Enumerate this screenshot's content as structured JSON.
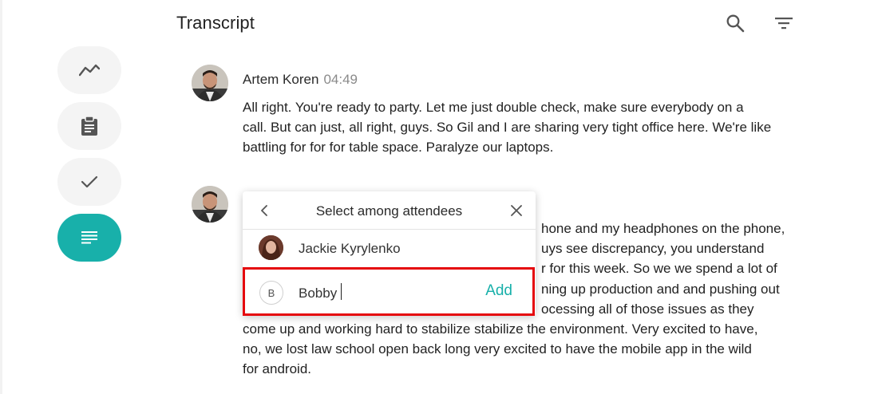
{
  "page": {
    "title": "Transcript"
  },
  "toolbar": {
    "search_icon": "search-icon",
    "filter_icon": "filter-icon"
  },
  "sidebar": {
    "items": [
      {
        "icon": "trend-icon",
        "active": false
      },
      {
        "icon": "clipboard-icon",
        "active": false
      },
      {
        "icon": "check-icon",
        "active": false
      },
      {
        "icon": "transcript-icon",
        "active": true
      }
    ],
    "accent_color": "#18b0aa"
  },
  "messages": [
    {
      "speaker": "Artem Koren",
      "time": "04:49",
      "lines": [
        "All right. You're ready to party. Let me just double check, make sure everybody on a",
        "call. But can just, all right, guys. So Gil and I are sharing very tight office here. We're like",
        "battling for for for table space. Paralyze our laptops."
      ]
    },
    {
      "speaker": "",
      "time": "",
      "lines": [
        "hone and my headphones on the phone,",
        "uys see discrepancy, you understand",
        "r for this week. So we we spend a lot of",
        "ning up production and and pushing out",
        "ocessing all of those issues as they",
        "come up and working hard to stabilize stabilize the environment. Very excited to have,",
        "no, we lost law school open back long very excited to have the mobile app in the wild",
        "for android."
      ]
    }
  ],
  "attendee_popup": {
    "title": "Select among attendees",
    "attendees": [
      {
        "name": "Jackie Kyrylenko"
      }
    ],
    "new_entry": {
      "initial": "B",
      "value": "Bobby",
      "add_label": "Add"
    }
  }
}
